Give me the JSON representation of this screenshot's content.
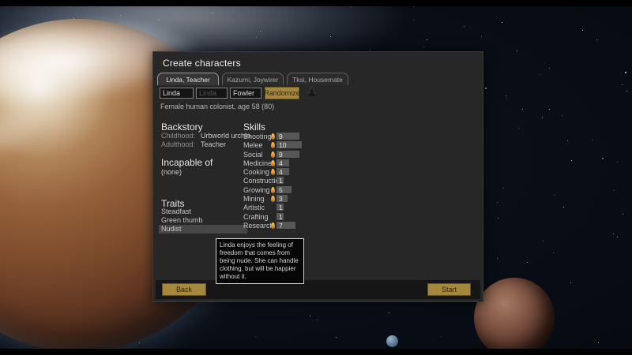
{
  "window": {
    "title": "Create characters"
  },
  "tabs": [
    {
      "label": "Linda, Teacher",
      "selected": true
    },
    {
      "label": "Kazumi, Joywirer",
      "selected": false
    },
    {
      "label": "Tksi, Housemate",
      "selected": false
    }
  ],
  "identity": {
    "first_name": "Linda",
    "nickname_placeholder": "Linda",
    "last_name": "Fowler",
    "randomize_label": "Randomize",
    "summary": "Female human colonist, age 58 (80)"
  },
  "backstory": {
    "heading": "Backstory",
    "rows": [
      {
        "label": "Childhood:",
        "value": "Urbworld urchin"
      },
      {
        "label": "Adulthood:",
        "value": "Teacher"
      }
    ]
  },
  "incapable": {
    "heading": "Incapable of",
    "value": "(none)"
  },
  "traits": {
    "heading": "Traits",
    "items": [
      "Steadfast",
      "Green thumb",
      "Nudist"
    ],
    "hovered": "Nudist"
  },
  "skills": {
    "heading": "Skills",
    "items": [
      {
        "name": "Shooting",
        "level": 9,
        "passion": true
      },
      {
        "name": "Melee",
        "level": 10,
        "passion": true
      },
      {
        "name": "Social",
        "level": 9,
        "passion": true
      },
      {
        "name": "Medicine",
        "level": 4,
        "passion": true
      },
      {
        "name": "Cooking",
        "level": 4,
        "passion": true
      },
      {
        "name": "Construction",
        "level": 1,
        "passion": false
      },
      {
        "name": "Growing",
        "level": 5,
        "passion": true
      },
      {
        "name": "Mining",
        "level": 3,
        "passion": true
      },
      {
        "name": "Artistic",
        "level": 1,
        "passion": false
      },
      {
        "name": "Crafting",
        "level": 1,
        "passion": false
      },
      {
        "name": "Research",
        "level": 7,
        "passion": true
      }
    ]
  },
  "tooltip": {
    "text": "Linda enjoys the feeling of freedom that comes from being nude. She can handle clothing, but will be happier without it."
  },
  "footer": {
    "back_label": "Back",
    "start_label": "Start"
  },
  "colors": {
    "accent_button": "#a5873e",
    "passion_flame": "#e8a33c",
    "dialog_bg": "#272727"
  }
}
